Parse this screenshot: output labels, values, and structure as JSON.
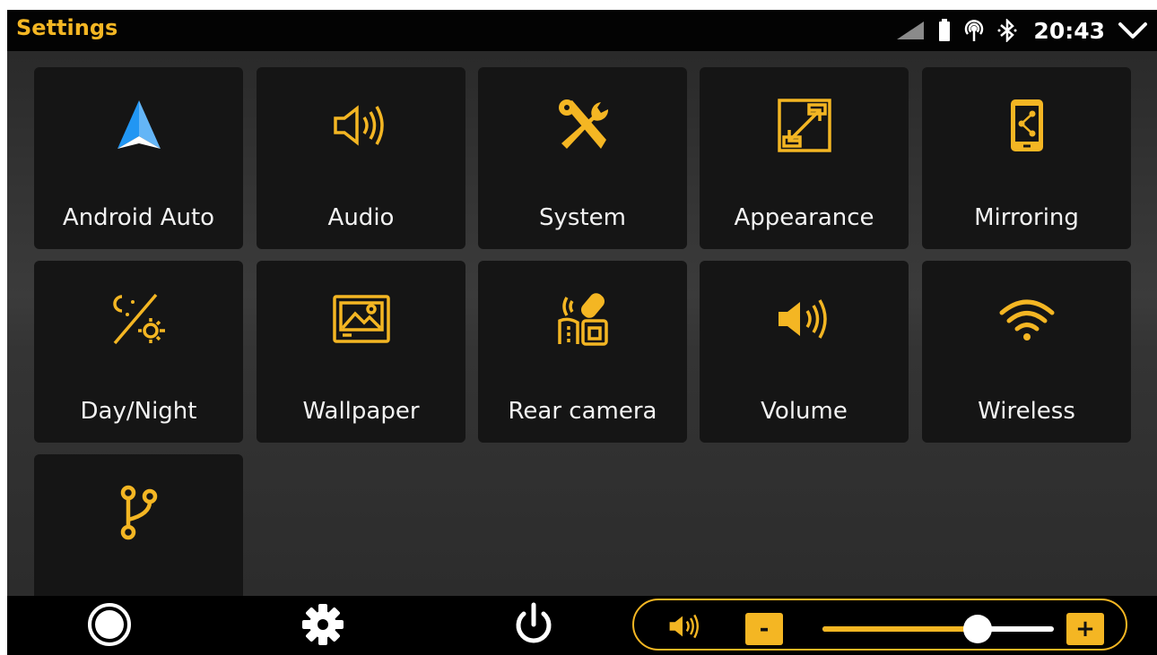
{
  "statusbar": {
    "title": "Settings",
    "time": "20:43",
    "icons": [
      "signal-icon",
      "battery-icon",
      "hotspot-icon",
      "bluetooth-icon",
      "chevron-down-icon"
    ]
  },
  "tiles": [
    {
      "label": "Android Auto",
      "icon": "android-auto-icon"
    },
    {
      "label": "Audio",
      "icon": "speaker-outline-icon"
    },
    {
      "label": "System",
      "icon": "tools-icon"
    },
    {
      "label": "Appearance",
      "icon": "resize-icon"
    },
    {
      "label": "Mirroring",
      "icon": "phone-share-icon"
    },
    {
      "label": "Day/Night",
      "icon": "day-night-icon"
    },
    {
      "label": "Wallpaper",
      "icon": "picture-icon"
    },
    {
      "label": "Rear camera",
      "icon": "rear-camera-icon"
    },
    {
      "label": "Volume",
      "icon": "speaker-filled-icon"
    },
    {
      "label": "Wireless",
      "icon": "wifi-icon"
    },
    {
      "label": "",
      "icon": "branch-icon"
    }
  ],
  "navbar": {
    "home_icon": "home-circle-icon",
    "settings_icon": "gear-icon",
    "power_icon": "power-icon",
    "volume": {
      "speaker_icon": "speaker-filled-icon",
      "minus_label": "-",
      "plus_label": "+",
      "level": 0.67
    }
  },
  "colors": {
    "accent": "#f4b623",
    "tile_bg": "#151515",
    "text": "#f2f2f2"
  }
}
